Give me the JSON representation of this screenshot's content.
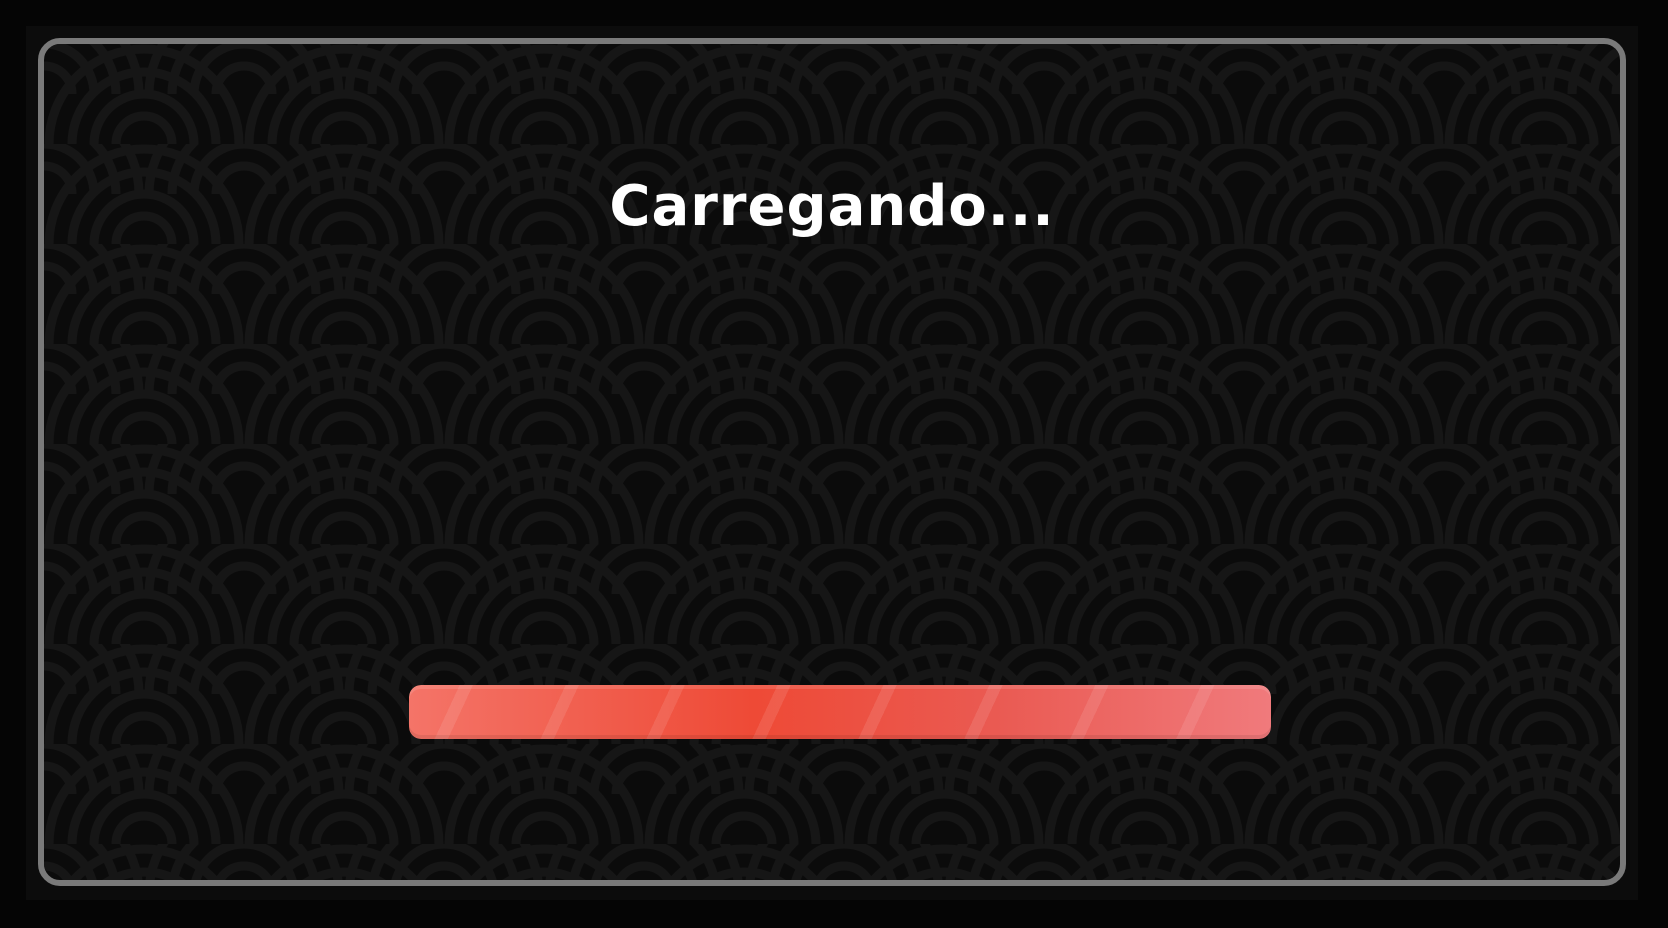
{
  "loading": {
    "title": "Carregando...",
    "progress_percent": 100
  },
  "colors": {
    "background": "#0b0b0b",
    "frame_border": "#7a7a7a",
    "pattern": "#161616",
    "bar_start": "#f47468",
    "bar_mid": "#ee4a36",
    "bar_end": "#f07a7c",
    "title": "#ffffff"
  }
}
